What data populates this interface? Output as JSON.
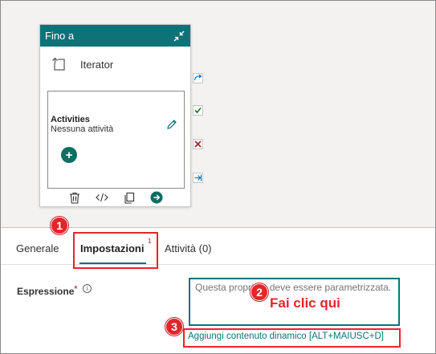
{
  "card": {
    "title": "Fino a",
    "iterator_label": "Iterator",
    "activities_title": "Activities",
    "activities_subtitle": "Nessuna attività"
  },
  "tabs": [
    {
      "label": "Generale",
      "active": false
    },
    {
      "label": "Impostazioni",
      "active": true,
      "superscript": "1"
    },
    {
      "label": "Attività (0)",
      "active": false
    }
  ],
  "expression": {
    "label": "Espressione",
    "required_mark": "*",
    "info_glyph": "i",
    "placeholder": "Questa proprietà deve essere parametrizzata.",
    "dynamic_content_link": "Aggiungi contenuto dinamico [ALT+MAIUSC+D]"
  },
  "annotations": {
    "badge1": "1",
    "badge2": "2",
    "badge3": "3",
    "callout_text": "Fai clic qui"
  },
  "colors": {
    "accent": "#0d7378",
    "callout": "#e5252a",
    "success": "#107c10",
    "error": "#a4262c"
  },
  "icons": [
    "collapse-icon",
    "iterator-icon",
    "edit-icon",
    "plus-icon",
    "delete-icon",
    "code-icon",
    "copy-icon",
    "arrow-right-circle-icon",
    "skip-handle-icon",
    "success-handle-icon",
    "failure-handle-icon",
    "completion-handle-icon",
    "info-icon"
  ]
}
